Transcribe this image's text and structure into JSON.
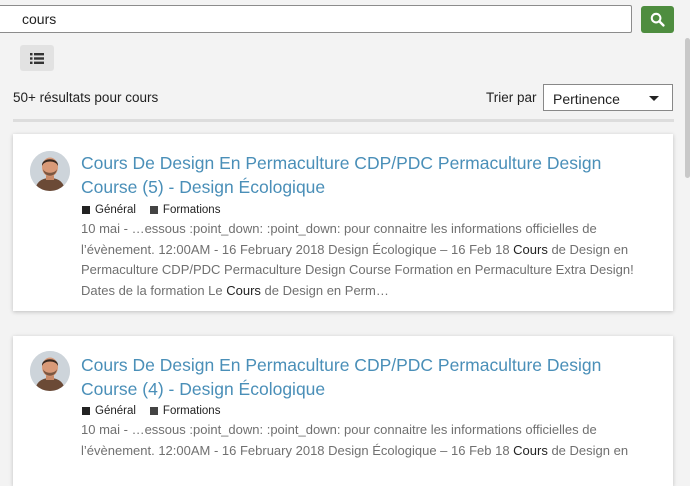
{
  "search": {
    "value": "cours"
  },
  "toolbar": {
    "search_icon": "search-icon",
    "view_icon": "list-icon"
  },
  "results": {
    "count_label": "50+ résultats pour cours"
  },
  "sort": {
    "label": "Trier par",
    "selected": "Pertinence"
  },
  "colors": {
    "accent": "#4a8fb8",
    "button_green": "#4e8d3f",
    "category_general": "#222222",
    "category_formations": "#444444"
  },
  "cards": [
    {
      "title": "Cours De Design En Permaculture CDP/PDC Permaculture Design Course (5) - Design Écologique",
      "categories": [
        "Général",
        "Formations"
      ],
      "excerpt": {
        "before": "10 mai - …essous :point_down: :point_down: pour connaitre les informations officielles de l’évènement. 12:00AM - 16 February 2018 Design Écologique – 16 Feb 18 ",
        "highlight1": "Cours",
        "middle": " de Design en Permaculture CDP/PDC Permaculture Design Course Formation en Permaculture Extra Design! Dates de la formation Le ",
        "highlight2": "Cours",
        "after": " de Design en Perm…"
      }
    },
    {
      "title": "Cours De Design En Permaculture CDP/PDC Permaculture Design Course (4) - Design Écologique",
      "categories": [
        "Général",
        "Formations"
      ],
      "excerpt": {
        "before": "10 mai - …essous :point_down: :point_down: pour connaitre les informations officielles de l’évènement. 12:00AM - 16 February 2018 Design Écologique – 16 Feb 18 ",
        "highlight1": "Cours",
        "middle": " de Design en",
        "highlight2": "",
        "after": ""
      }
    }
  ]
}
